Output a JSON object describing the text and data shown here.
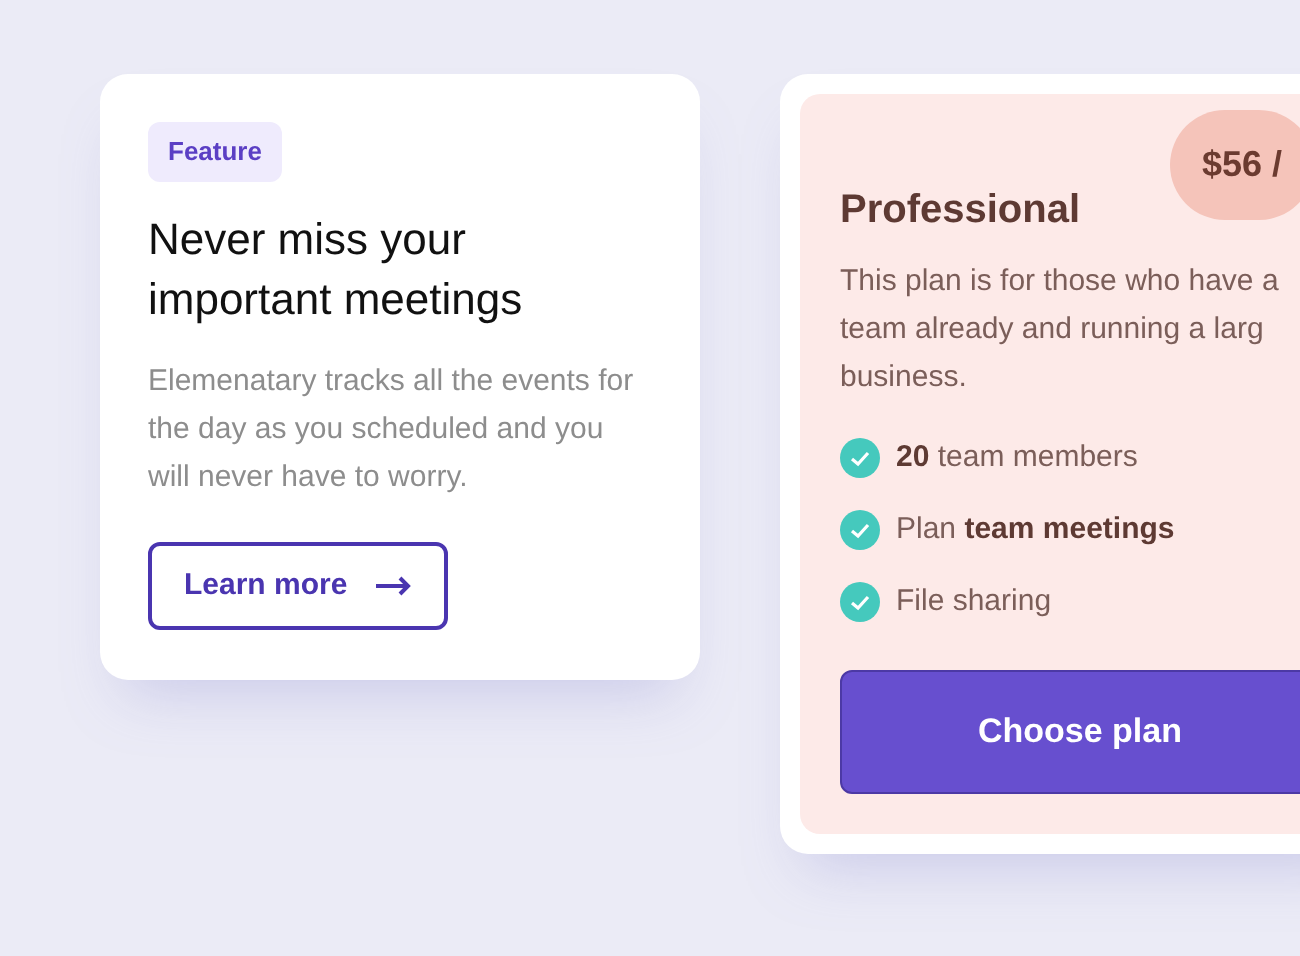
{
  "feature_card": {
    "tag": "Feature",
    "title": "Never miss your important meetings",
    "description": "Elemenatary tracks all the events for the day as you scheduled and you will never have to worry.",
    "button": "Learn more"
  },
  "plan_card": {
    "price": "$56 /",
    "name": "Professional",
    "description_lines": [
      "This plan is for those who have a",
      "team already and running a larg",
      "business."
    ],
    "features": [
      {
        "text": "**20** team members",
        "checked": true
      },
      {
        "text": "Plan **team meetings**",
        "checked": true
      },
      {
        "text": "File sharing",
        "checked": true
      }
    ],
    "button": "Choose plan"
  }
}
